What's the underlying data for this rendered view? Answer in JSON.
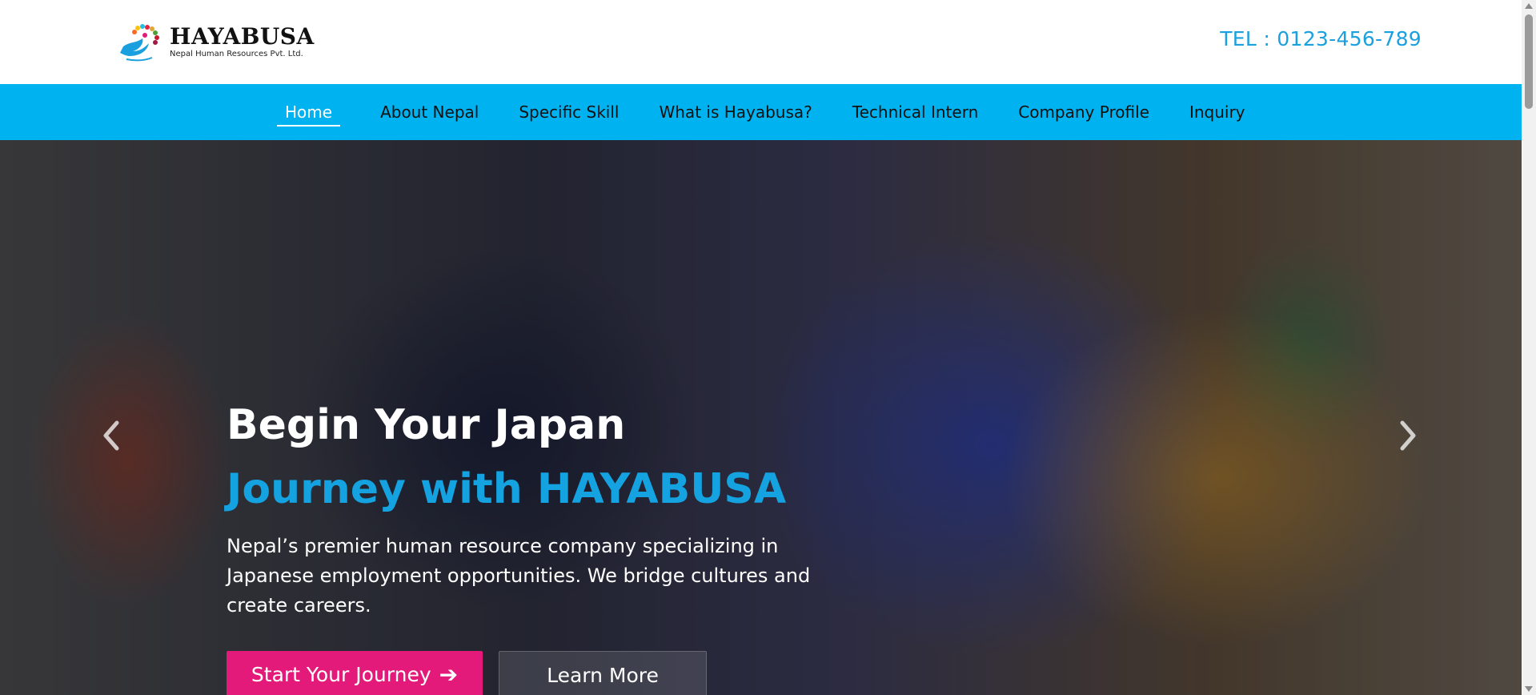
{
  "header": {
    "brand_name": "HAYABUSA",
    "brand_subtitle": "Nepal Human Resources Pvt. Ltd.",
    "phone": "TEL : 0123-456-789"
  },
  "nav": {
    "items": [
      {
        "label": "Home"
      },
      {
        "label": "About Nepal"
      },
      {
        "label": "Specific Skill"
      },
      {
        "label": "What is Hayabusa?"
      },
      {
        "label": "Technical Intern"
      },
      {
        "label": "Company Profile"
      },
      {
        "label": "Inquiry"
      }
    ]
  },
  "hero": {
    "title_line1": "Begin Your Japan",
    "title_line2": "Journey with HAYABUSA",
    "description": "Nepal’s premier human resource company specializing in Japanese employment opportunities. We bridge cultures and create careers.",
    "primary_button": "Start Your Journey",
    "secondary_button": "Learn More",
    "prev_icon": "chevron-left-icon",
    "next_icon": "chevron-right-icon"
  },
  "colors": {
    "nav_background": "#00b2f0",
    "phone_text": "#1aa0de",
    "accent_blue": "#14a3e0",
    "primary_button": "#e31a7a"
  }
}
